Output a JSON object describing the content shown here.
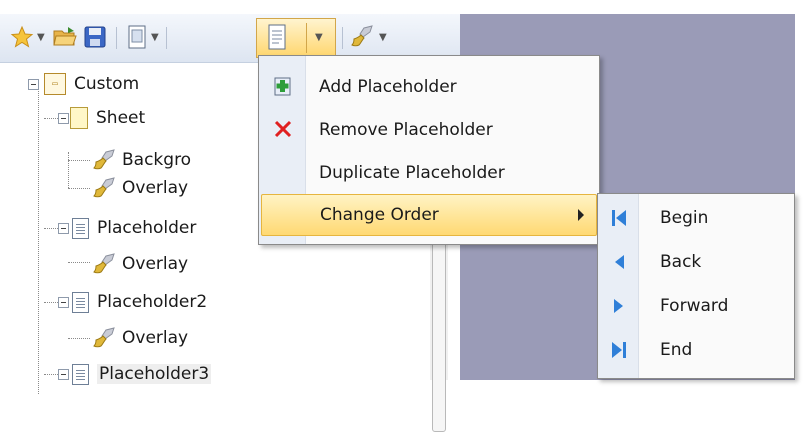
{
  "toolbar": {
    "buttons": [
      {
        "name": "favorites",
        "icon": "star-icon"
      },
      {
        "name": "open",
        "icon": "open-folder-icon"
      },
      {
        "name": "save",
        "icon": "save-disk-icon"
      },
      {
        "name": "page-dropdown",
        "icon": "page-icon"
      },
      {
        "name": "placeholder-dropdown",
        "icon": "document-icon",
        "active": true
      },
      {
        "name": "brush-dropdown",
        "icon": "brush-icon"
      }
    ]
  },
  "tree": {
    "nodes": [
      {
        "label": "Custom",
        "icon": "custom-layout-icon",
        "level": 0
      },
      {
        "label": "Sheet",
        "icon": "sheet-icon",
        "level": 1
      },
      {
        "label": "Backgro",
        "icon": "brush-icon",
        "level": 2
      },
      {
        "label": "Overlay",
        "icon": "brush-icon",
        "level": 2
      },
      {
        "label": "Placeholder",
        "icon": "page-icon",
        "level": 1
      },
      {
        "label": "Overlay",
        "icon": "brush-icon",
        "level": 2
      },
      {
        "label": "Placeholder2",
        "icon": "page-icon",
        "level": 1
      },
      {
        "label": "Overlay",
        "icon": "brush-icon",
        "level": 2
      },
      {
        "label": "Placeholder3",
        "icon": "page-icon",
        "level": 1
      }
    ]
  },
  "menu": {
    "items": [
      {
        "label": "Add Placeholder",
        "icon": "add-placeholder-icon"
      },
      {
        "label": "Remove Placeholder",
        "icon": "remove-x-icon"
      },
      {
        "label": "Duplicate Placeholder",
        "icon": ""
      },
      {
        "label": "Change Order",
        "icon": "",
        "submenu": true,
        "highlighted": true
      }
    ]
  },
  "submenu": {
    "items": [
      {
        "label": "Begin",
        "icon": "skip-to-start-icon"
      },
      {
        "label": "Back",
        "icon": "step-back-icon"
      },
      {
        "label": "Forward",
        "icon": "step-forward-icon"
      },
      {
        "label": "End",
        "icon": "skip-to-end-icon"
      }
    ]
  },
  "colors": {
    "workspace": "#9a9bb7",
    "highlight": "#ffd973",
    "nav_blue": "#2f7fd8",
    "remove_red": "#e02020"
  }
}
